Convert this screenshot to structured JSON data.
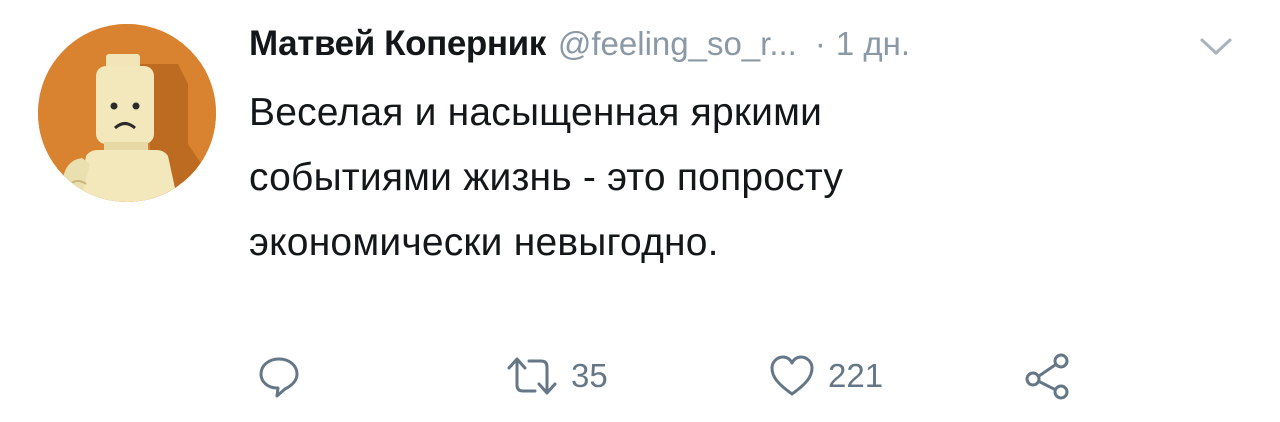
{
  "tweet": {
    "author": {
      "display_name": "Матвей Коперник",
      "handle": "@feeling_so_r...",
      "avatar_icon": "lego-minifigure-sad-avatar"
    },
    "separator": "·",
    "time": "1 дн.",
    "menu_icon": "chevron-down-icon",
    "text_lines": [
      "Веселая и насыщенная яркими",
      "событиями жизнь - это попросту",
      "экономически невыгодно."
    ],
    "actions": {
      "reply": {
        "icon": "reply-icon"
      },
      "retweet": {
        "icon": "retweet-icon",
        "count": "35"
      },
      "like": {
        "icon": "heart-icon",
        "count": "221"
      },
      "share": {
        "icon": "share-icon"
      }
    },
    "colors": {
      "avatar_bg": "#d9822f",
      "text": "#14171a",
      "muted": "#8b98a5",
      "icon": "#657786"
    }
  }
}
